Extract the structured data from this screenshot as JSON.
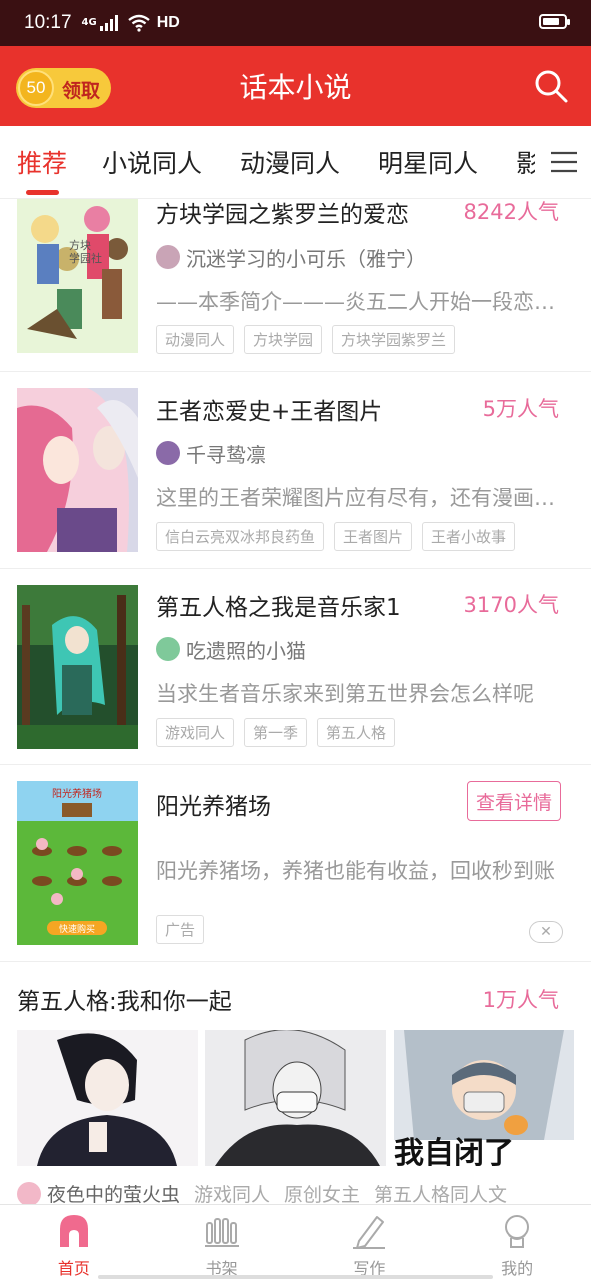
{
  "status": {
    "time": "10:17",
    "network": "4G",
    "hd": "HD",
    "battery_level": 0.8
  },
  "header": {
    "coin_value": "50",
    "claim_label": "领取",
    "title": "话本小说"
  },
  "tabs": [
    "推荐",
    "小说同人",
    "动漫同人",
    "明星同人",
    "影视"
  ],
  "items": [
    {
      "title": "方块学园之紫罗兰的爱恋",
      "popularity": "8242人气",
      "author": "沉迷学习的小可乐（雅宁）",
      "desc": "——本季简介———炎五二人开始一段恋情……",
      "tags": [
        "动漫同人",
        "方块学园",
        "方块学园紫罗兰"
      ],
      "cover_text": "方块 学园社"
    },
    {
      "title": "王者恋爱史+王者图片",
      "popularity": "5万人气",
      "author": "千寻鸷凛",
      "desc": "这里的王者荣耀图片应有尽有，还有漫画故事",
      "tags": [
        "信白云亮双冰邦良药鱼",
        "王者图片",
        "王者小故事"
      ]
    },
    {
      "title": "第五人格之我是音乐家1",
      "popularity": "3170人气",
      "author": "吃遗照的小猫",
      "desc": "当求生者音乐家来到第五世界会怎么样呢",
      "tags": [
        "游戏同人",
        "第一季",
        "第五人格"
      ]
    }
  ],
  "ad": {
    "title": "阳光养猪场",
    "button": "查看详情",
    "desc": "阳光养猪场，养猪也能有收益，回收秒到账",
    "tag": "广告",
    "banner": "阳光养猪场",
    "game_button": "快速购买"
  },
  "featured": {
    "title": "第五人格:我和你一起",
    "popularity": "1万人气",
    "image_text": "我自闭了",
    "author": "夜色中的萤火虫",
    "tags": [
      "游戏同人",
      "原创女主",
      "第五人格同人文"
    ]
  },
  "nav": [
    {
      "label": "首页",
      "icon": "home-icon",
      "active": true
    },
    {
      "label": "书架",
      "icon": "bookshelf-icon",
      "active": false
    },
    {
      "label": "写作",
      "icon": "pencil-icon",
      "active": false
    },
    {
      "label": "我的",
      "icon": "profile-icon",
      "active": false
    }
  ],
  "colors": {
    "primary": "#e8322c",
    "pink": "#e86b9a",
    "status_bar": "#3a1012"
  }
}
